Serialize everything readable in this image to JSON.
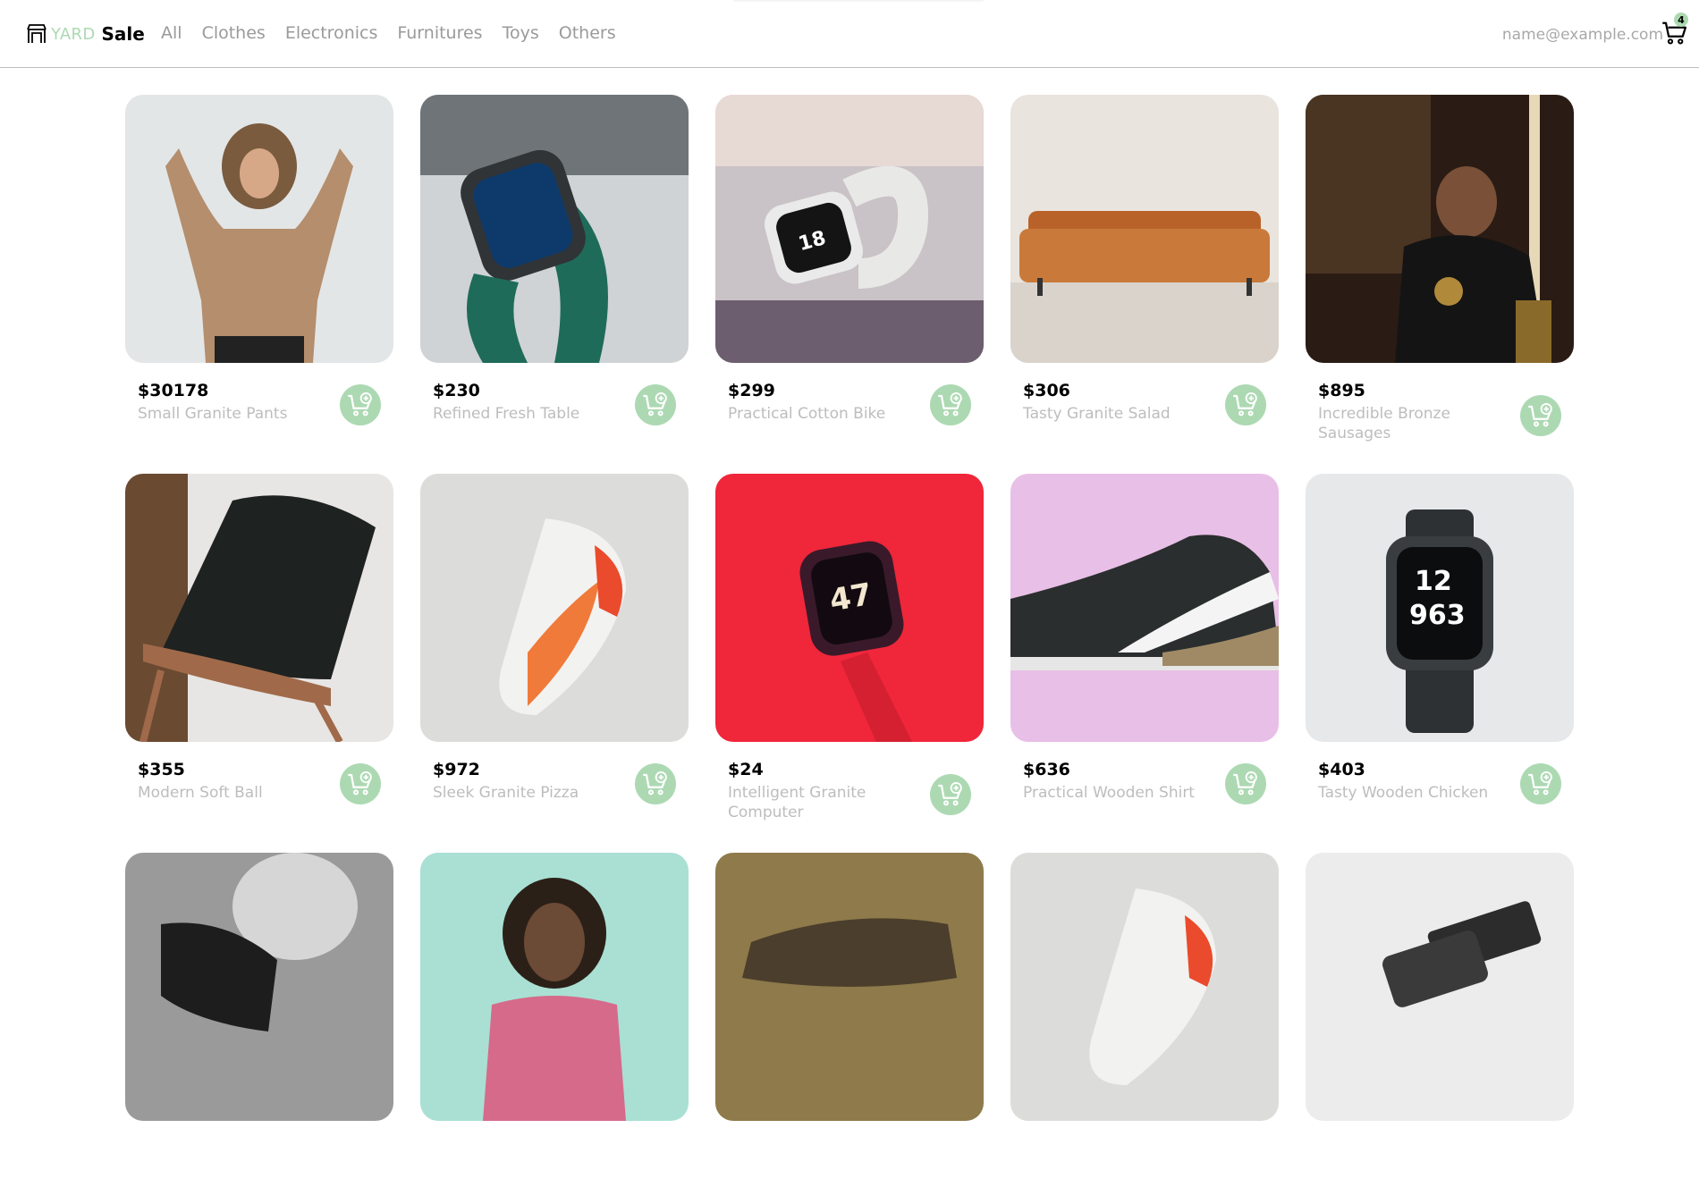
{
  "brand": {
    "yard": "YARD",
    "sale": "Sale"
  },
  "nav": {
    "links": [
      "All",
      "Clothes",
      "Electronics",
      "Furnitures",
      "Toys",
      "Others"
    ]
  },
  "user": {
    "email": "name@example.com"
  },
  "cart": {
    "count": "4"
  },
  "colors": {
    "accent": "#acd9b2",
    "muted_text": "#bdbdbd",
    "nav_text": "#9a9a9a"
  },
  "products": [
    {
      "price": "$30178",
      "name": "Small Granite Pants"
    },
    {
      "price": "$230",
      "name": "Refined Fresh Table"
    },
    {
      "price": "$299",
      "name": "Practical Cotton Bike"
    },
    {
      "price": "$306",
      "name": "Tasty Granite Salad"
    },
    {
      "price": "$895",
      "name": "Incredible Bronze Sausages"
    },
    {
      "price": "$355",
      "name": "Modern Soft Ball"
    },
    {
      "price": "$972",
      "name": "Sleek Granite Pizza"
    },
    {
      "price": "$24",
      "name": "Intelligent Granite Computer"
    },
    {
      "price": "$636",
      "name": "Practical Wooden Shirt"
    },
    {
      "price": "$403",
      "name": "Tasty Wooden Chicken"
    }
  ],
  "icons": {
    "logo": "shop-front-icon",
    "cart": "shopping-cart-icon",
    "add_to_cart": "cart-plus-icon"
  }
}
